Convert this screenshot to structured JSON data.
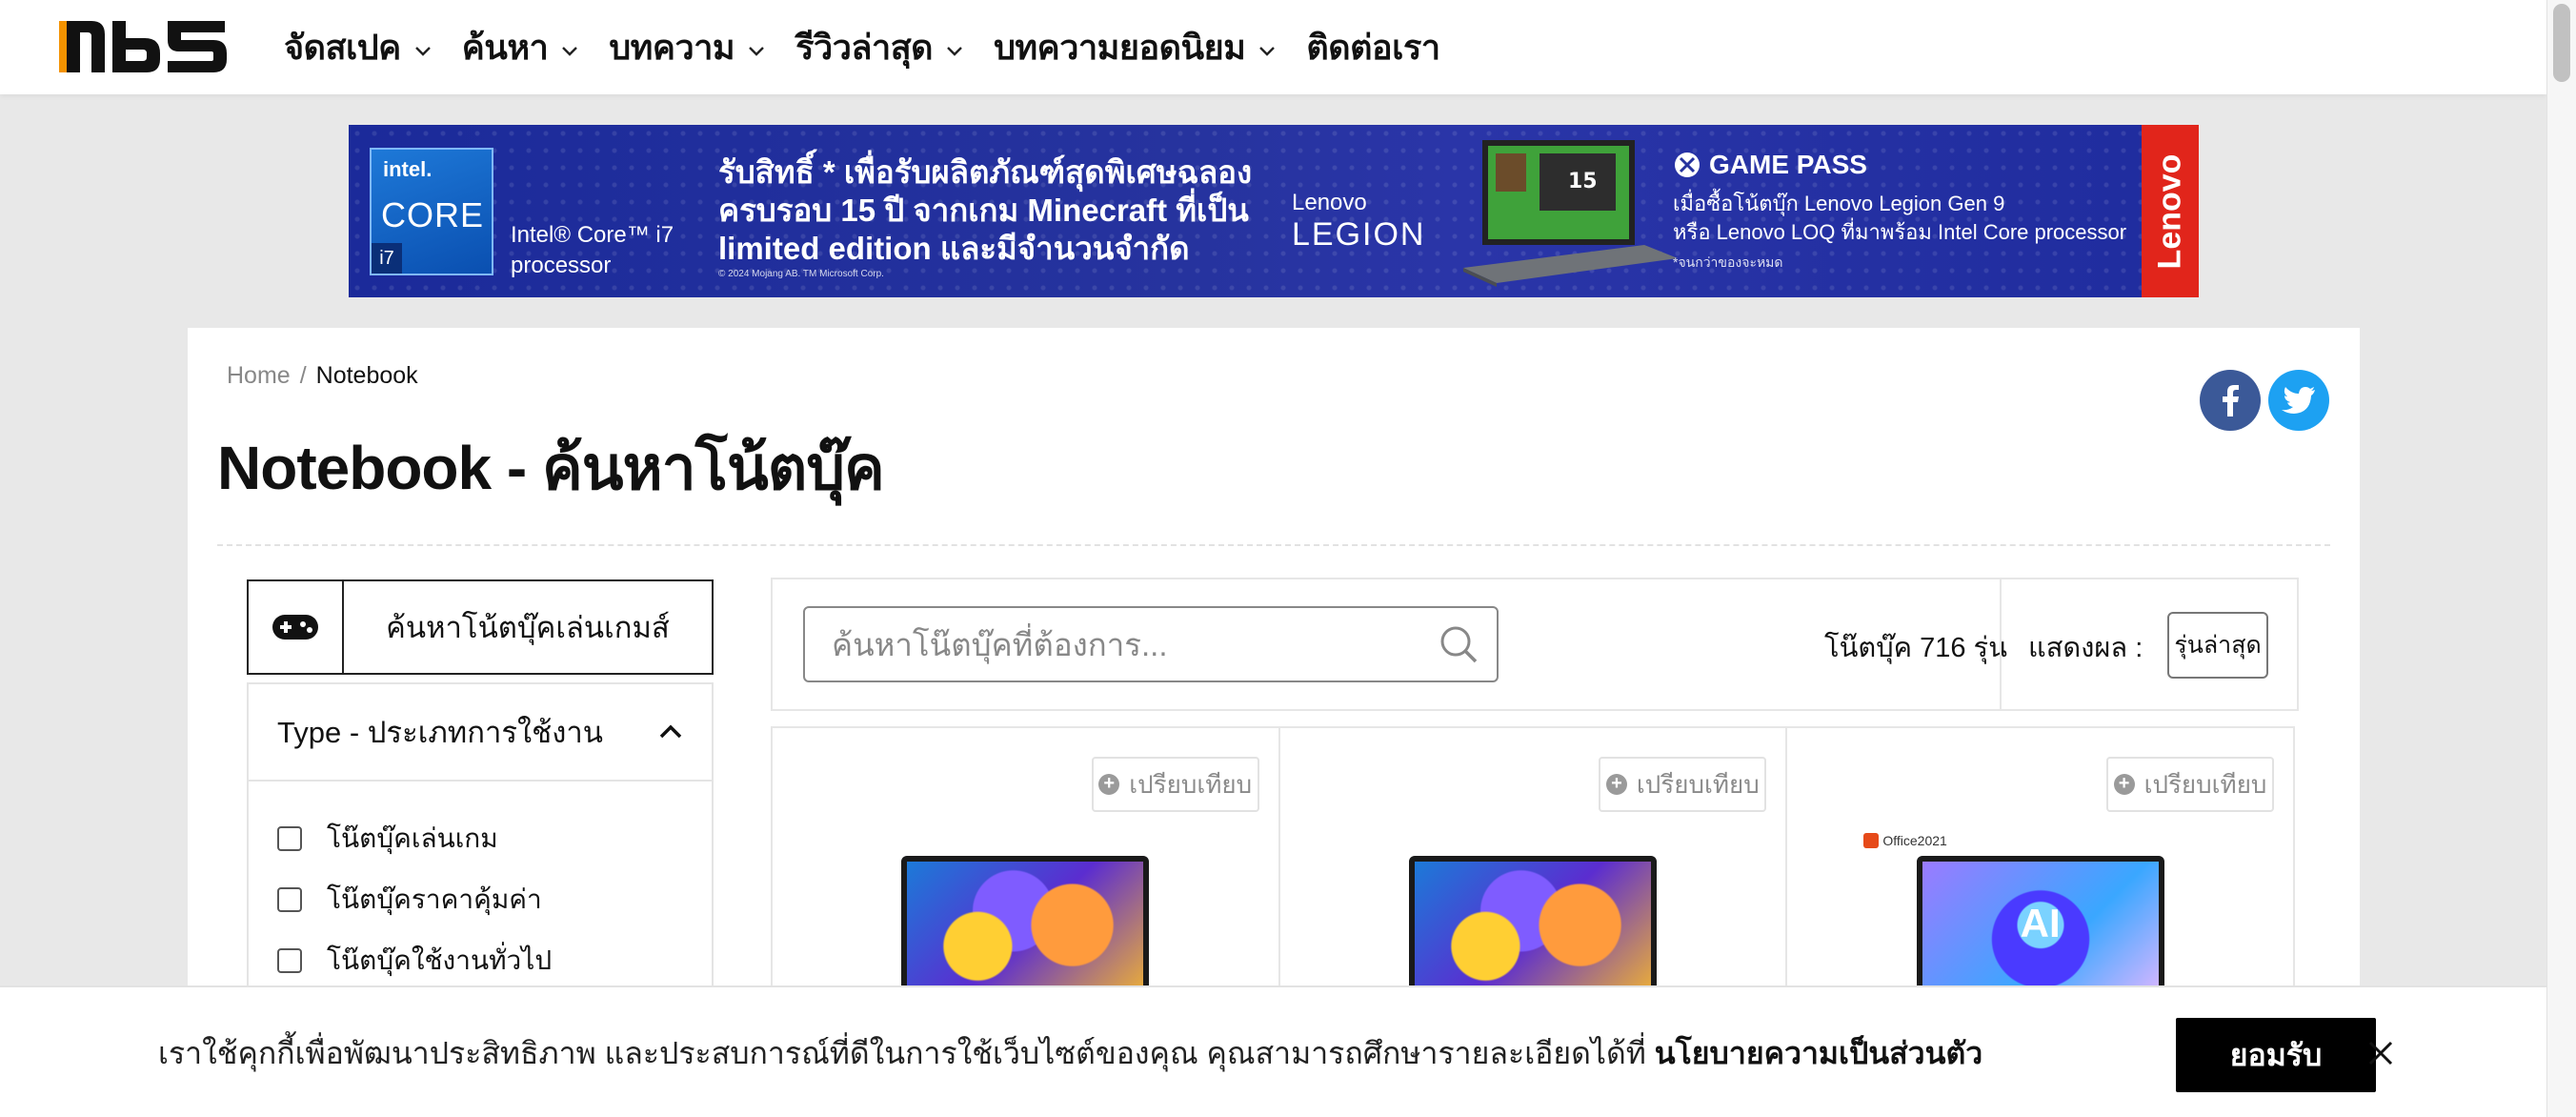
{
  "nav": {
    "menu": [
      {
        "label": "จัดสเปค",
        "has_dropdown": true
      },
      {
        "label": "ค้นหา",
        "has_dropdown": true
      },
      {
        "label": "บทความ",
        "has_dropdown": true
      },
      {
        "label": "รีวิวล่าสุด",
        "has_dropdown": true
      },
      {
        "label": "บทความยอดนิยม",
        "has_dropdown": true
      },
      {
        "label": "ติดต่อเรา",
        "has_dropdown": false
      }
    ]
  },
  "banner": {
    "intel_badge": {
      "brand": "intel.",
      "core": "CORE",
      "tier": "i7"
    },
    "intel_caption": "Intel® Core™ i7 processor",
    "promo_lines": [
      "รับสิทธิ์ * เพื่อรับผลิตภัณฑ์สุดพิเศษฉลอง",
      "ครบรอบ 15 ปี จากเกม Minecraft ที่เป็น",
      "limited edition และมีจำนวนจำกัด"
    ],
    "promo_fine": "© 2024 Mojang AB. TM Microsoft Corp.",
    "legion_top": "Lenovo",
    "legion_bottom": "LEGION",
    "gamepass_title": "GAME PASS",
    "gamepass_lines": [
      "เมื่อซื้อโน้ตบุ๊ก Lenovo Legion Gen 9",
      "หรือ Lenovo LOQ ที่มาพร้อม Intel Core processor"
    ],
    "gamepass_fine": "*จนกว่าของจะหมด",
    "side_brand": "Lenovo",
    "colors": {
      "background": "#1f2c9e",
      "side_strip": "#e1251b"
    }
  },
  "breadcrumb": {
    "home": "Home",
    "separator": "/",
    "current": "Notebook"
  },
  "page_title": "Notebook - ค้นหาโน้ตบุ๊ค",
  "social": {
    "facebook_color": "#3b5998",
    "twitter_color": "#1da1f2"
  },
  "sidebar": {
    "game_search_label": "ค้นหาโน้ตบุ๊คเล่นเกมส์",
    "filter": {
      "title": "Type - ประเภทการใช้งาน",
      "expanded": true,
      "options": [
        {
          "label": "โน๊ตบุ๊คเล่นเกม",
          "checked": false
        },
        {
          "label": "โน๊ตบุ๊คราคาคุ้มค่า",
          "checked": false
        },
        {
          "label": "โน๊ตบุ๊คใช้งานทั่วไป",
          "checked": false
        }
      ]
    }
  },
  "toolbar": {
    "search_placeholder": "ค้นหาโน๊ตบุ๊คที่ต้องการ...",
    "count_text": "โน๊ตบุ๊ค 716 รุ่น",
    "sort_label": "แสดงผล :",
    "sort_value": "รุ่นล่าสุด"
  },
  "products": [
    {
      "compare_label": "เปรียบเทียบ",
      "image": "zenbook-oled-wallpaper"
    },
    {
      "compare_label": "เปรียบเทียบ",
      "image": "zenbook-oled-wallpaper"
    },
    {
      "compare_label": "เปรียบเทียบ",
      "image": "ai-laptop-wallpaper",
      "tag": "Office2021",
      "screen_text": "AI"
    }
  ],
  "cookie": {
    "text": "เราใช้คุกกี้เพื่อพัฒนาประสิทธิภาพ และประสบการณ์ที่ดีในการใช้เว็บไซต์ของคุณ คุณสามารถศึกษารายละเอียดได้ที่",
    "link": "นโยบายความเป็นส่วนตัว",
    "accept": "ยอมรับ"
  }
}
